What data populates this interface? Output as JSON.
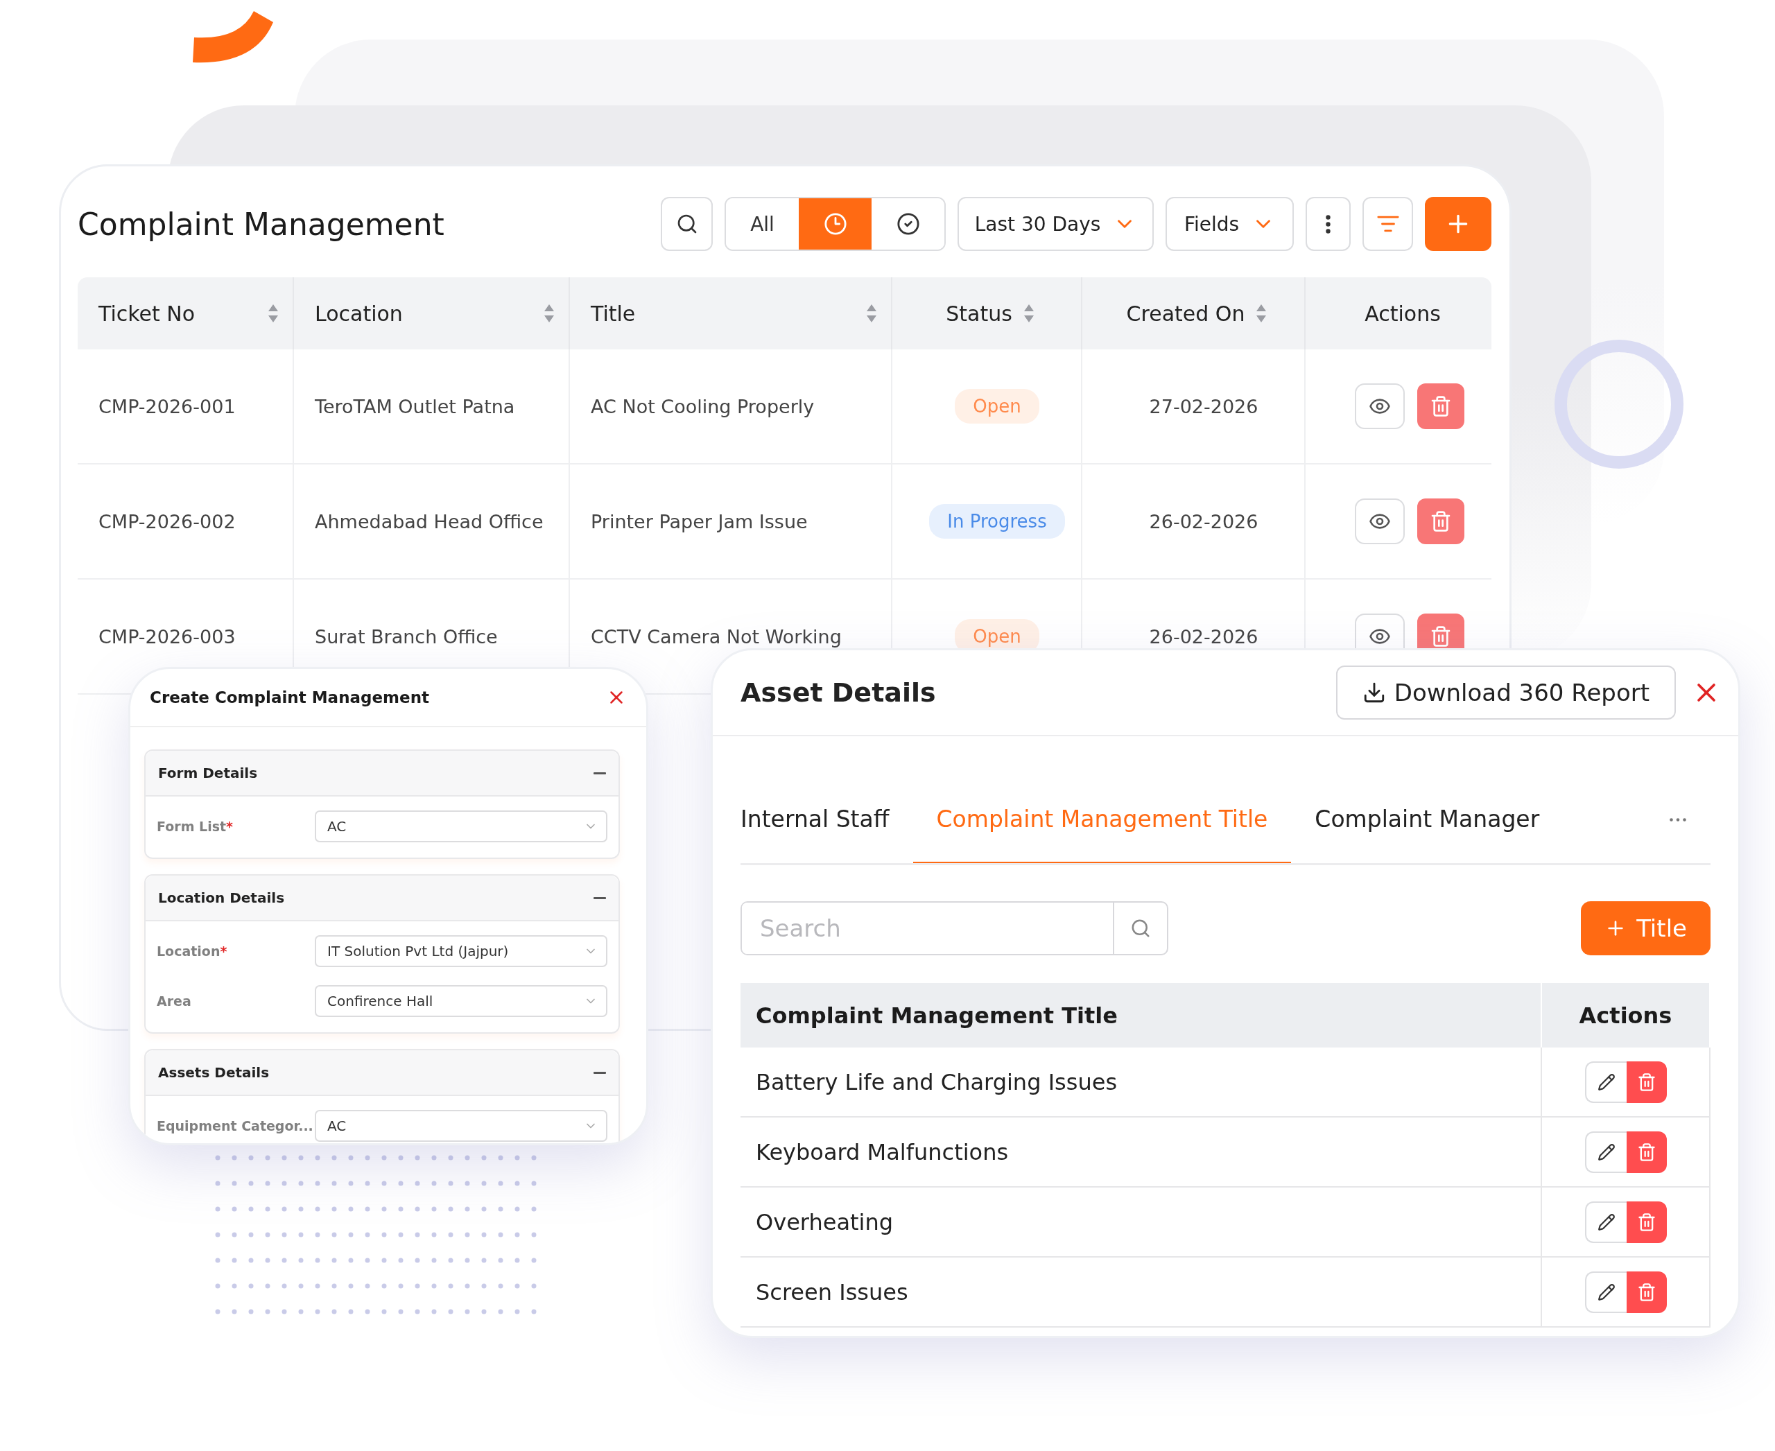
{
  "main": {
    "title": "Complaint Management",
    "toolbar": {
      "segments": [
        {
          "kind": "text",
          "label": "All",
          "selected": false
        },
        {
          "kind": "clock",
          "selected": true
        },
        {
          "kind": "check",
          "selected": false
        }
      ],
      "period": "Last 30 Days",
      "fields": "Fields"
    },
    "table": {
      "columns": [
        {
          "label": "Ticket No",
          "sortable": true
        },
        {
          "label": "Location",
          "sortable": true
        },
        {
          "label": "Title",
          "sortable": true
        },
        {
          "label": "Status",
          "sortable": true
        },
        {
          "label": "Created On",
          "sortable": true
        },
        {
          "label": "Actions",
          "sortable": false
        }
      ],
      "rows": [
        {
          "ticket": "CMP-2026-001",
          "location": "TeroTAM Outlet Patna",
          "title": "AC Not Cooling Properly",
          "status": {
            "label": "Open",
            "kind": "open"
          },
          "created": "27-02-2026"
        },
        {
          "ticket": "CMP-2026-002",
          "location": "Ahmedabad Head Office",
          "title": "Printer Paper Jam Issue",
          "status": {
            "label": "In Progress",
            "kind": "progress"
          },
          "created": "26-02-2026"
        },
        {
          "ticket": "CMP-2026-003",
          "location": "Surat Branch Office",
          "title": "CCTV Camera Not Working",
          "status": {
            "label": "Open",
            "kind": "open"
          },
          "created": "26-02-2026"
        }
      ]
    }
  },
  "create_dialog": {
    "title": "Create Complaint Management",
    "sections": [
      {
        "title": "Form Details",
        "fields": [
          {
            "label": "Form List",
            "required_mark": "*",
            "value": "AC"
          }
        ]
      },
      {
        "title": "Location Details",
        "fields": [
          {
            "label": "Location",
            "required_mark": "*",
            "value": "IT Solution Pvt Ltd (Jajpur)"
          },
          {
            "label": "Area",
            "value": "Confirence Hall"
          }
        ]
      },
      {
        "title": "Assets Details",
        "fields": [
          {
            "label": "Equipment Categor...",
            "value": "AC"
          }
        ]
      }
    ]
  },
  "asset_dialog": {
    "title": "Asset Details",
    "download": "Download 360 Report",
    "tabs": [
      {
        "label": "Internal Staff",
        "selected": false
      },
      {
        "label": "Complaint Management Title",
        "selected": true
      },
      {
        "label": "Complaint Manager",
        "selected": false
      }
    ],
    "search": {
      "placeholder": "Search"
    },
    "add_button": "Title",
    "table": {
      "columns": [
        "Complaint Management Title",
        "Actions"
      ],
      "rows": [
        "Battery Life and Charging Issues",
        "Keyboard Malfunctions",
        "Overheating",
        "Screen Issues"
      ]
    }
  }
}
